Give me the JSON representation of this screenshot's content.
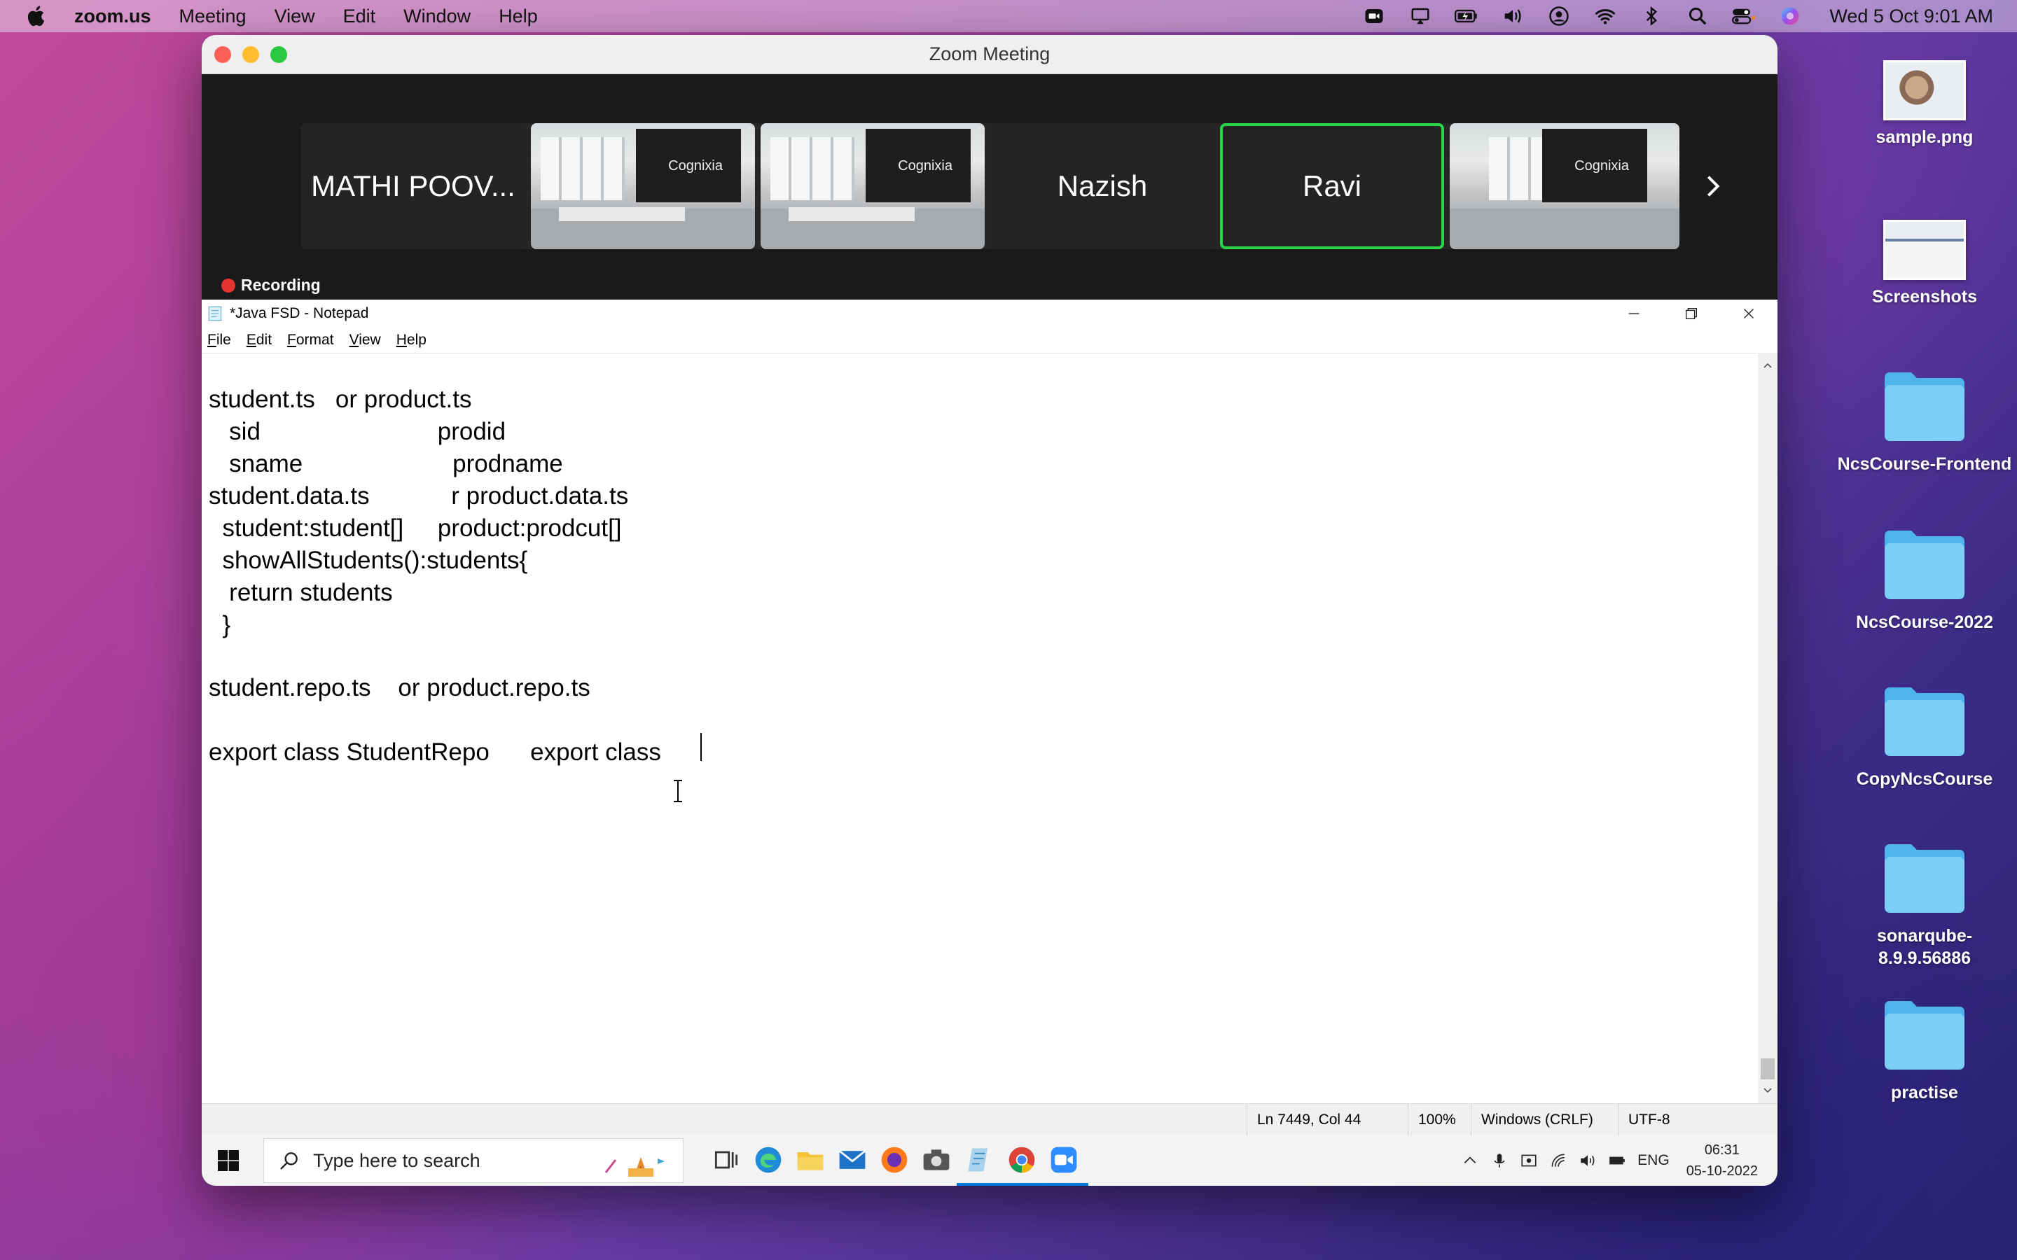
{
  "menubar": {
    "app_name": "zoom.us",
    "items": [
      "Meeting",
      "View",
      "Edit",
      "Window",
      "Help"
    ],
    "clock": "Wed 5 Oct  9:01 AM"
  },
  "zoom": {
    "window_title": "Zoom Meeting",
    "participants": [
      {
        "name": "MATHI POOV...",
        "video": false,
        "active": false
      },
      {
        "name": "",
        "video": true,
        "brand": "Cognixia",
        "active": false
      },
      {
        "name": "",
        "video": true,
        "brand": "Cognixia",
        "active": false
      },
      {
        "name": "Nazish",
        "video": false,
        "active": false
      },
      {
        "name": "Ravi",
        "video": false,
        "active": true
      },
      {
        "name": "",
        "video": true,
        "brand": "Cognixia",
        "active": false
      }
    ],
    "recording_label": "Recording"
  },
  "notepad": {
    "title": "*Java FSD - Notepad",
    "menu": [
      "File",
      "Edit",
      "Format",
      "View",
      "Help"
    ],
    "lines": [
      "student.ts   or product.ts",
      "   sid                          prodid",
      "   sname                      prodname",
      "student.data.ts            r product.data.ts",
      "  student:student[]     product:prodcut[]",
      "  showAllStudents():students{",
      "   return students",
      "  }",
      "",
      "student.repo.ts    or product.repo.ts",
      "",
      "export class StudentRepo      export class "
    ],
    "status": {
      "position": "Ln 7449, Col 44",
      "zoom": "100%",
      "line_ending": "Windows (CRLF)",
      "encoding": "UTF-8"
    }
  },
  "taskbar": {
    "search_placeholder": "Type here to search",
    "tray_language": "ENG",
    "tray_time": "06:31",
    "tray_date": "05-10-2022"
  },
  "desktop": {
    "items": [
      {
        "label": "sample.png",
        "type": "image"
      },
      {
        "label": "Screenshots",
        "type": "image"
      },
      {
        "label": "NcsCourse-Frontend",
        "type": "folder"
      },
      {
        "label": "NcsCourse-2022",
        "type": "folder"
      },
      {
        "label": "CopyNcsCourse",
        "type": "folder"
      },
      {
        "label": "sonarqube-8.9.9.56886",
        "type": "folder"
      },
      {
        "label": "practise",
        "type": "folder"
      }
    ]
  },
  "colors": {
    "active_speaker": "#2bd54a",
    "recording_dot": "#e3342f",
    "folder_blue": "#6cc4f5"
  }
}
